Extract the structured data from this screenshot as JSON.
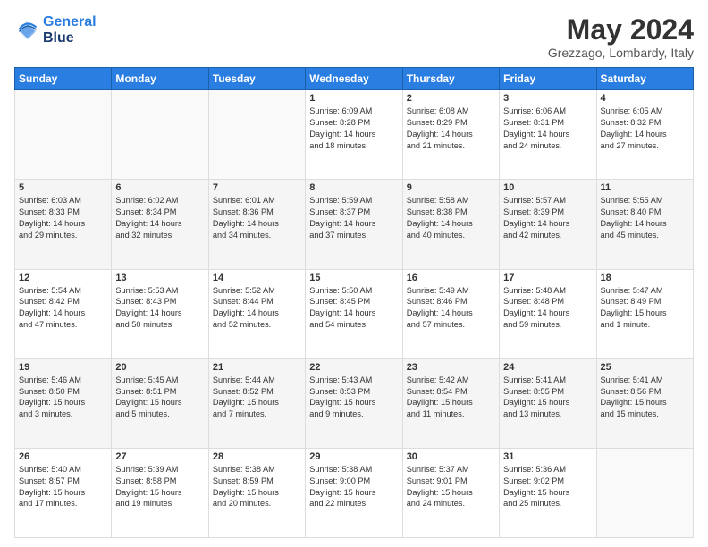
{
  "logo": {
    "line1": "General",
    "line2": "Blue"
  },
  "title": "May 2024",
  "location": "Grezzago, Lombardy, Italy",
  "days_header": [
    "Sunday",
    "Monday",
    "Tuesday",
    "Wednesday",
    "Thursday",
    "Friday",
    "Saturday"
  ],
  "weeks": [
    [
      {
        "day": "",
        "info": ""
      },
      {
        "day": "",
        "info": ""
      },
      {
        "day": "",
        "info": ""
      },
      {
        "day": "1",
        "info": "Sunrise: 6:09 AM\nSunset: 8:28 PM\nDaylight: 14 hours\nand 18 minutes."
      },
      {
        "day": "2",
        "info": "Sunrise: 6:08 AM\nSunset: 8:29 PM\nDaylight: 14 hours\nand 21 minutes."
      },
      {
        "day": "3",
        "info": "Sunrise: 6:06 AM\nSunset: 8:31 PM\nDaylight: 14 hours\nand 24 minutes."
      },
      {
        "day": "4",
        "info": "Sunrise: 6:05 AM\nSunset: 8:32 PM\nDaylight: 14 hours\nand 27 minutes."
      }
    ],
    [
      {
        "day": "5",
        "info": "Sunrise: 6:03 AM\nSunset: 8:33 PM\nDaylight: 14 hours\nand 29 minutes."
      },
      {
        "day": "6",
        "info": "Sunrise: 6:02 AM\nSunset: 8:34 PM\nDaylight: 14 hours\nand 32 minutes."
      },
      {
        "day": "7",
        "info": "Sunrise: 6:01 AM\nSunset: 8:36 PM\nDaylight: 14 hours\nand 34 minutes."
      },
      {
        "day": "8",
        "info": "Sunrise: 5:59 AM\nSunset: 8:37 PM\nDaylight: 14 hours\nand 37 minutes."
      },
      {
        "day": "9",
        "info": "Sunrise: 5:58 AM\nSunset: 8:38 PM\nDaylight: 14 hours\nand 40 minutes."
      },
      {
        "day": "10",
        "info": "Sunrise: 5:57 AM\nSunset: 8:39 PM\nDaylight: 14 hours\nand 42 minutes."
      },
      {
        "day": "11",
        "info": "Sunrise: 5:55 AM\nSunset: 8:40 PM\nDaylight: 14 hours\nand 45 minutes."
      }
    ],
    [
      {
        "day": "12",
        "info": "Sunrise: 5:54 AM\nSunset: 8:42 PM\nDaylight: 14 hours\nand 47 minutes."
      },
      {
        "day": "13",
        "info": "Sunrise: 5:53 AM\nSunset: 8:43 PM\nDaylight: 14 hours\nand 50 minutes."
      },
      {
        "day": "14",
        "info": "Sunrise: 5:52 AM\nSunset: 8:44 PM\nDaylight: 14 hours\nand 52 minutes."
      },
      {
        "day": "15",
        "info": "Sunrise: 5:50 AM\nSunset: 8:45 PM\nDaylight: 14 hours\nand 54 minutes."
      },
      {
        "day": "16",
        "info": "Sunrise: 5:49 AM\nSunset: 8:46 PM\nDaylight: 14 hours\nand 57 minutes."
      },
      {
        "day": "17",
        "info": "Sunrise: 5:48 AM\nSunset: 8:48 PM\nDaylight: 14 hours\nand 59 minutes."
      },
      {
        "day": "18",
        "info": "Sunrise: 5:47 AM\nSunset: 8:49 PM\nDaylight: 15 hours\nand 1 minute."
      }
    ],
    [
      {
        "day": "19",
        "info": "Sunrise: 5:46 AM\nSunset: 8:50 PM\nDaylight: 15 hours\nand 3 minutes."
      },
      {
        "day": "20",
        "info": "Sunrise: 5:45 AM\nSunset: 8:51 PM\nDaylight: 15 hours\nand 5 minutes."
      },
      {
        "day": "21",
        "info": "Sunrise: 5:44 AM\nSunset: 8:52 PM\nDaylight: 15 hours\nand 7 minutes."
      },
      {
        "day": "22",
        "info": "Sunrise: 5:43 AM\nSunset: 8:53 PM\nDaylight: 15 hours\nand 9 minutes."
      },
      {
        "day": "23",
        "info": "Sunrise: 5:42 AM\nSunset: 8:54 PM\nDaylight: 15 hours\nand 11 minutes."
      },
      {
        "day": "24",
        "info": "Sunrise: 5:41 AM\nSunset: 8:55 PM\nDaylight: 15 hours\nand 13 minutes."
      },
      {
        "day": "25",
        "info": "Sunrise: 5:41 AM\nSunset: 8:56 PM\nDaylight: 15 hours\nand 15 minutes."
      }
    ],
    [
      {
        "day": "26",
        "info": "Sunrise: 5:40 AM\nSunset: 8:57 PM\nDaylight: 15 hours\nand 17 minutes."
      },
      {
        "day": "27",
        "info": "Sunrise: 5:39 AM\nSunset: 8:58 PM\nDaylight: 15 hours\nand 19 minutes."
      },
      {
        "day": "28",
        "info": "Sunrise: 5:38 AM\nSunset: 8:59 PM\nDaylight: 15 hours\nand 20 minutes."
      },
      {
        "day": "29",
        "info": "Sunrise: 5:38 AM\nSunset: 9:00 PM\nDaylight: 15 hours\nand 22 minutes."
      },
      {
        "day": "30",
        "info": "Sunrise: 5:37 AM\nSunset: 9:01 PM\nDaylight: 15 hours\nand 24 minutes."
      },
      {
        "day": "31",
        "info": "Sunrise: 5:36 AM\nSunset: 9:02 PM\nDaylight: 15 hours\nand 25 minutes."
      },
      {
        "day": "",
        "info": ""
      }
    ]
  ]
}
